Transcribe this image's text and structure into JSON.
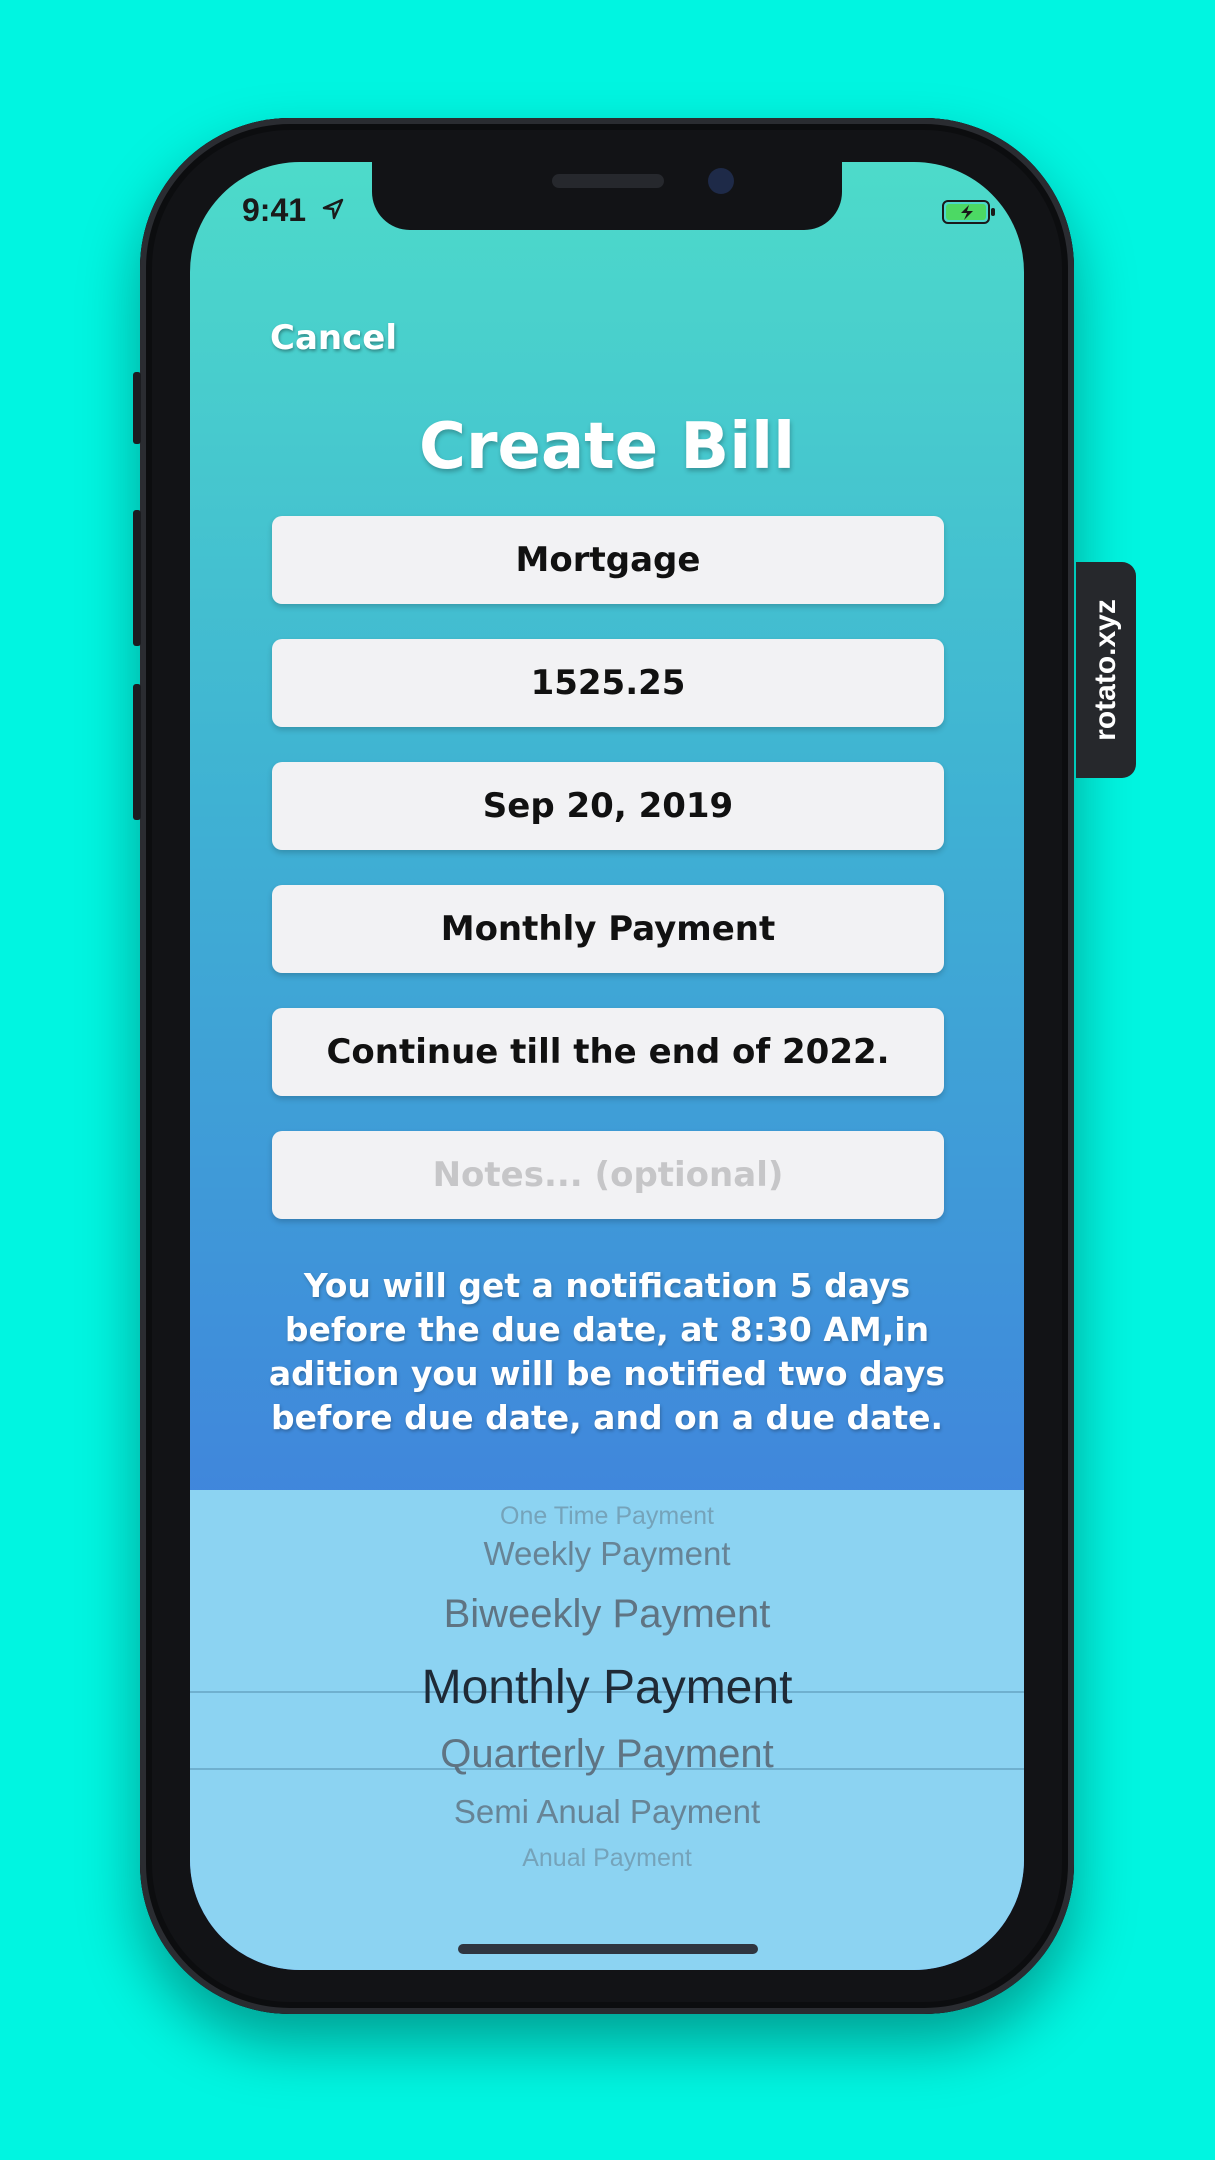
{
  "status_bar": {
    "time": "9:41"
  },
  "header": {
    "cancel_label": "Cancel",
    "title": "Create Bill"
  },
  "form": {
    "name": "Mortgage",
    "amount": "1525.25",
    "due_date": "Sep 20, 2019",
    "frequency": "Monthly Payment",
    "end": "Continue till the end of 2022.",
    "notes_placeholder": "Notes... (optional)"
  },
  "notification_text": "You will get a notification 5 days before the due date, at 8:30 AM,in adition you will be notified two days before due date, and on a due date.",
  "picker": {
    "options": [
      "One Time Payment",
      "Weekly Payment",
      "Biweekly Payment",
      "Monthly Payment",
      "Quarterly Payment",
      "Semi Anual Payment",
      "Anual Payment"
    ],
    "selected": "Monthly Payment"
  },
  "watermark": "rotato.xyz",
  "colors": {
    "background": "#00f5e1",
    "gradient_top": "#4ddbca",
    "gradient_bottom": "#4469e0",
    "picker_bg": "#8cd3f2"
  }
}
